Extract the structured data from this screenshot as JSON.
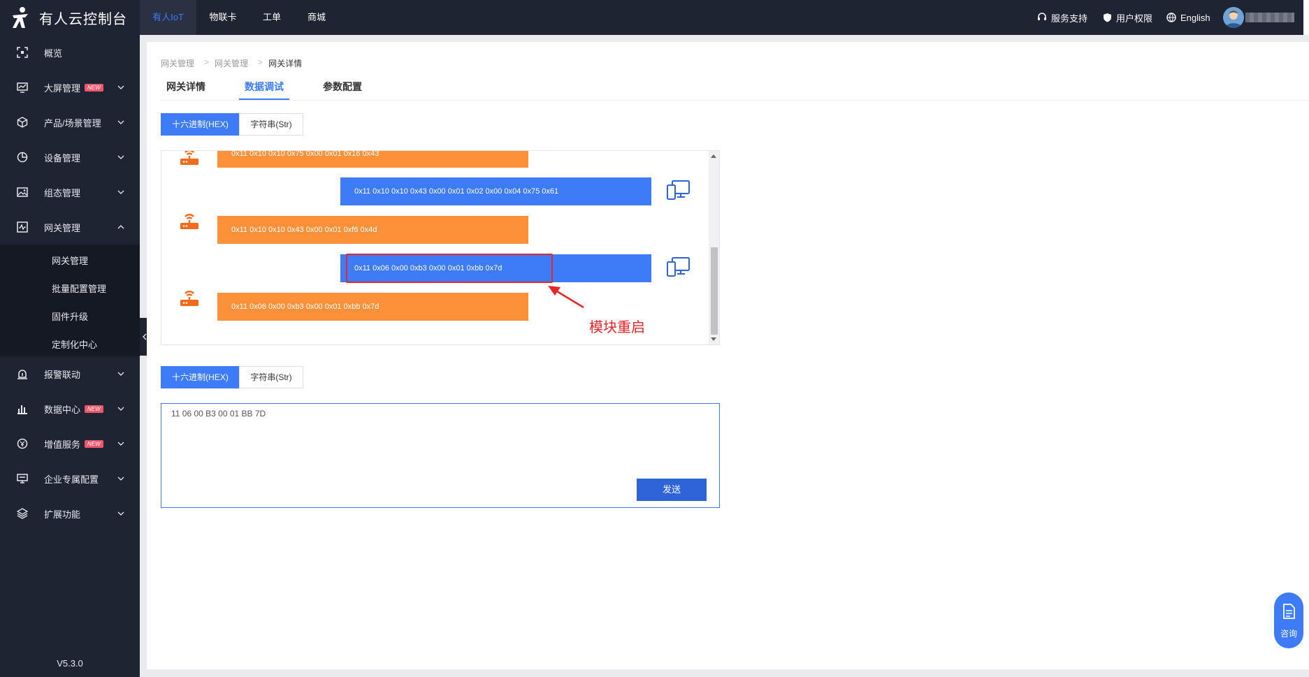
{
  "app": {
    "title": "有人云控制台",
    "version": "V5.3.0"
  },
  "topnav": [
    {
      "label": "有人IoT",
      "active": true
    },
    {
      "label": "物联卡"
    },
    {
      "label": "工单"
    },
    {
      "label": "商城"
    }
  ],
  "topright": {
    "support": "服务支持",
    "permissions": "用户权限",
    "language": "English"
  },
  "sidebar": {
    "items": [
      {
        "label": "概览",
        "icon": "overview-icon"
      },
      {
        "label": "大屏管理",
        "icon": "screen-icon",
        "badge": "NEW"
      },
      {
        "label": "产品/场景管理",
        "icon": "cube-icon"
      },
      {
        "label": "设备管理",
        "icon": "pie-icon"
      },
      {
        "label": "组态管理",
        "icon": "image-icon"
      },
      {
        "label": "网关管理",
        "icon": "gateway-icon",
        "expanded": true
      },
      {
        "label": "报警联动",
        "icon": "alarm-icon"
      },
      {
        "label": "数据中心",
        "icon": "bar-chart-icon",
        "badge": "NEW"
      },
      {
        "label": "增值服务",
        "icon": "value-icon",
        "badge": "NEW"
      },
      {
        "label": "企业专属配置",
        "icon": "monitor-icon"
      },
      {
        "label": "扩展功能",
        "icon": "layers-icon"
      }
    ],
    "submenu": [
      "网关管理",
      "批量配置管理",
      "固件升级",
      "定制化中心"
    ]
  },
  "breadcrumb": [
    "网关管理",
    "网关管理",
    "网关详情"
  ],
  "tabs": [
    "网关详情",
    "数据调试",
    "参数配置"
  ],
  "active_tab": "数据调试",
  "format_toggle": {
    "hex": "十六进制(HEX)",
    "str": "字符串(Str)",
    "selected": "hex"
  },
  "log": [
    {
      "direction": "device",
      "text": "0x11 0x10 0x10 0x75 0x00 0x01 0x16 0x43"
    },
    {
      "direction": "server",
      "text": "0x11 0x10 0x10 0x43 0x00 0x01 0x02 0x00 0x04 0x75 0x61"
    },
    {
      "direction": "device",
      "text": "0x11 0x10 0x10 0x43 0x00 0x01 0xf6 0x4d"
    },
    {
      "direction": "server",
      "text": "0x11 0x06 0x00 0xb3 0x00 0x01 0xbb 0x7d"
    },
    {
      "direction": "device",
      "text": "0x11 0x06 0x00 0xb3 0x00 0x01 0xbb 0x7d"
    }
  ],
  "annotation": "模块重启",
  "send_toggle": {
    "hex": "十六进制(HEX)",
    "str": "字符串(Str)",
    "selected": "hex"
  },
  "send": {
    "value": "11 06 00 B3 00 01 BB 7D",
    "button": "发送"
  },
  "consult": "咨询",
  "colors": {
    "accent": "#3d7bf7",
    "device_msg": "#fd913a",
    "server_msg": "#3d7bf7",
    "annotation": "#e8262a",
    "sidebar": "#1f2433"
  }
}
